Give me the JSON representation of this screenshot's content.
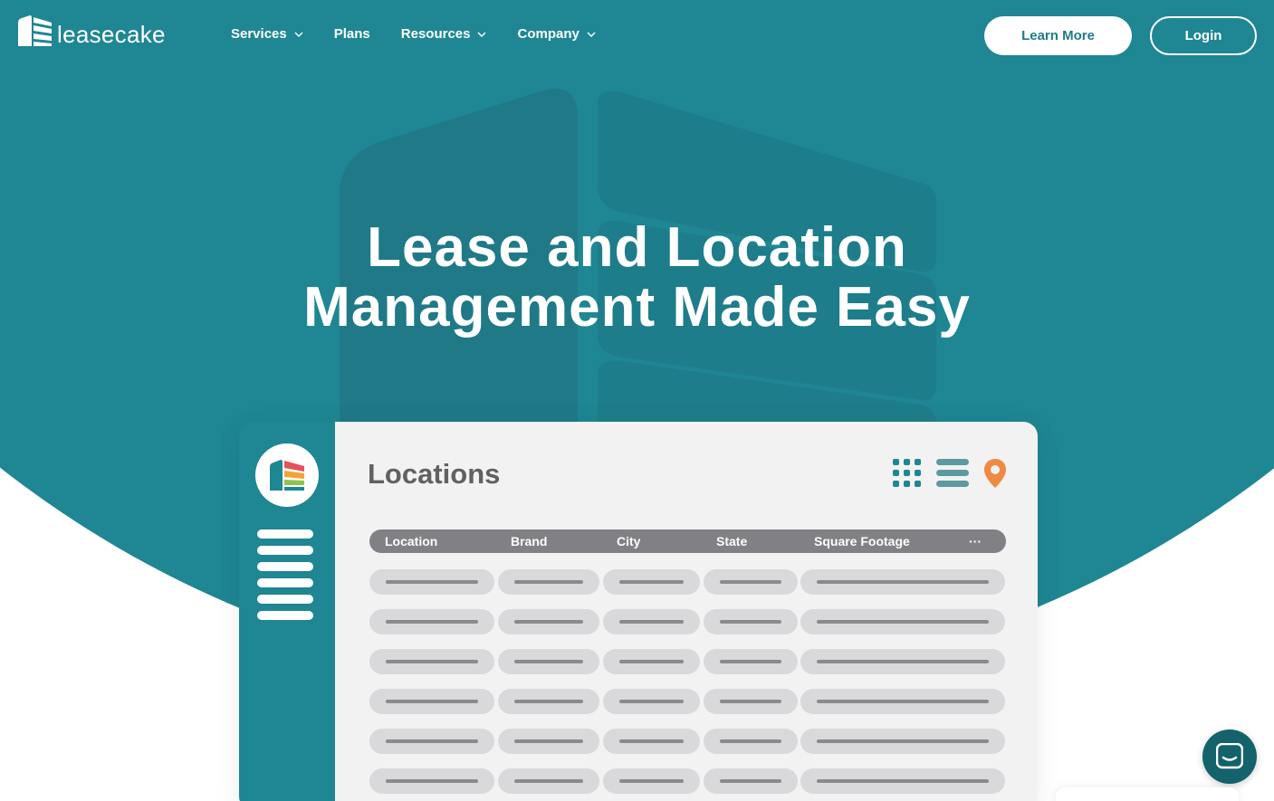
{
  "brand": {
    "name": "leasecake",
    "accent": "#1f8693",
    "accent_dark": "#14626b"
  },
  "nav": {
    "items": [
      {
        "label": "Services",
        "has_dropdown": true
      },
      {
        "label": "Plans",
        "has_dropdown": false
      },
      {
        "label": "Resources",
        "has_dropdown": true
      },
      {
        "label": "Company",
        "has_dropdown": true
      }
    ],
    "learn_more_label": "Learn More",
    "login_label": "Login"
  },
  "hero": {
    "title_line1": "Lease and Location",
    "title_line2": "Management Made Easy"
  },
  "app_mockup": {
    "title": "Locations",
    "view_icons": [
      "grid-view-icon",
      "list-view-icon",
      "map-pin-icon"
    ],
    "columns": [
      "Location",
      "Brand",
      "City",
      "State",
      "Square Footage",
      "···"
    ],
    "placeholder_row_count": 6
  },
  "chat": {
    "icon": "chat-icon"
  }
}
